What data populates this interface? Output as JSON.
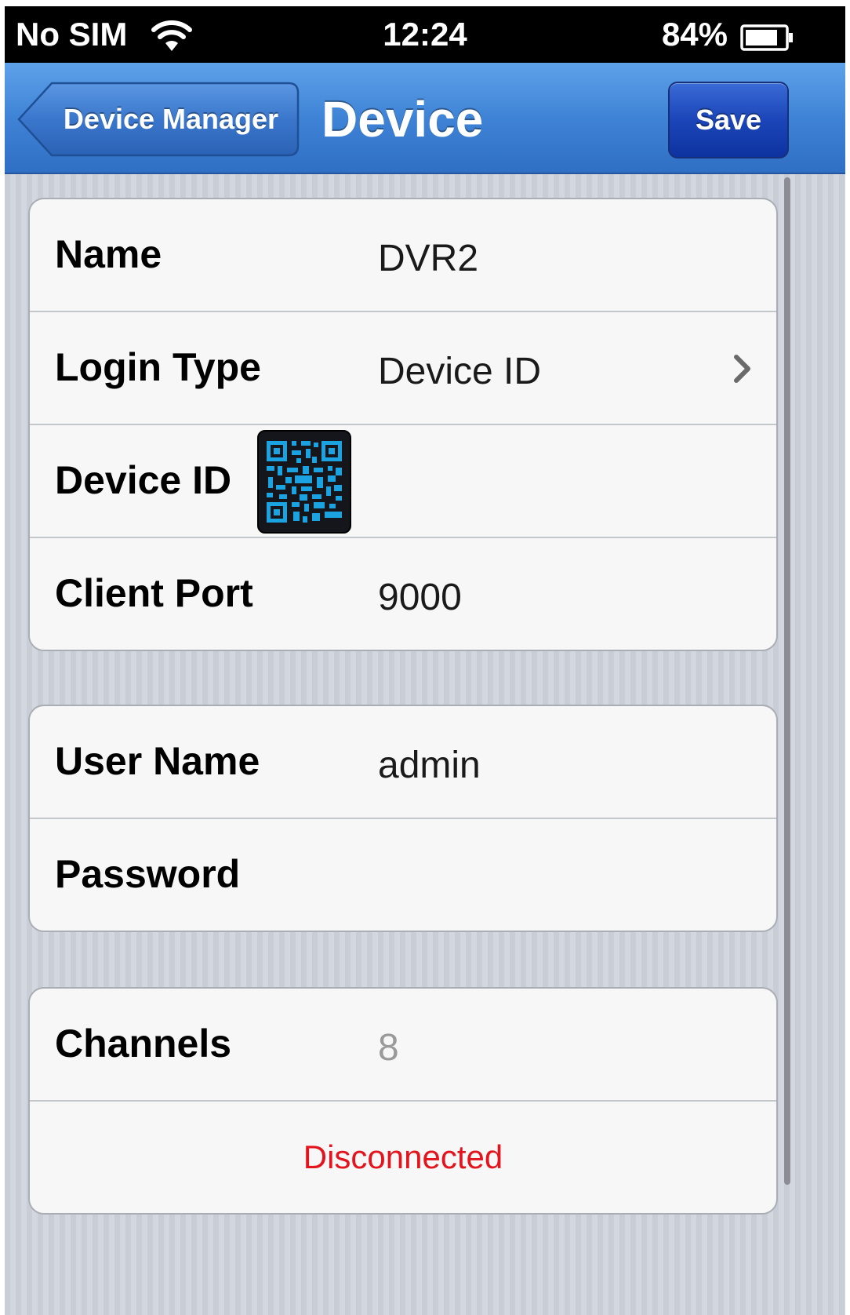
{
  "status_bar": {
    "carrier": "No SIM",
    "time": "12:24",
    "battery_percent": "84%",
    "battery_level": 0.84
  },
  "nav": {
    "back_label": "Device Manager",
    "title": "Device",
    "save_label": "Save"
  },
  "group1": {
    "name_label": "Name",
    "name_value": "DVR2",
    "login_type_label": "Login Type",
    "login_type_value": "Device ID",
    "device_id_label": "Device ID",
    "device_id_value": "",
    "client_port_label": "Client Port",
    "client_port_value": "9000"
  },
  "group2": {
    "user_name_label": "User Name",
    "user_name_value": "admin",
    "password_label": "Password",
    "password_value": ""
  },
  "group3": {
    "channels_label": "Channels",
    "channels_value": "8",
    "connection_status": "Disconnected"
  },
  "icons": {
    "wifi": "wifi-icon",
    "battery": "battery-icon",
    "chevron": "chevron-right-icon",
    "qr": "qr-code-icon"
  },
  "colors": {
    "nav_blue": "#3f83d6",
    "save_blue": "#1b45b8",
    "status_red": "#e3141d",
    "qr_cyan": "#1aa3e0"
  }
}
